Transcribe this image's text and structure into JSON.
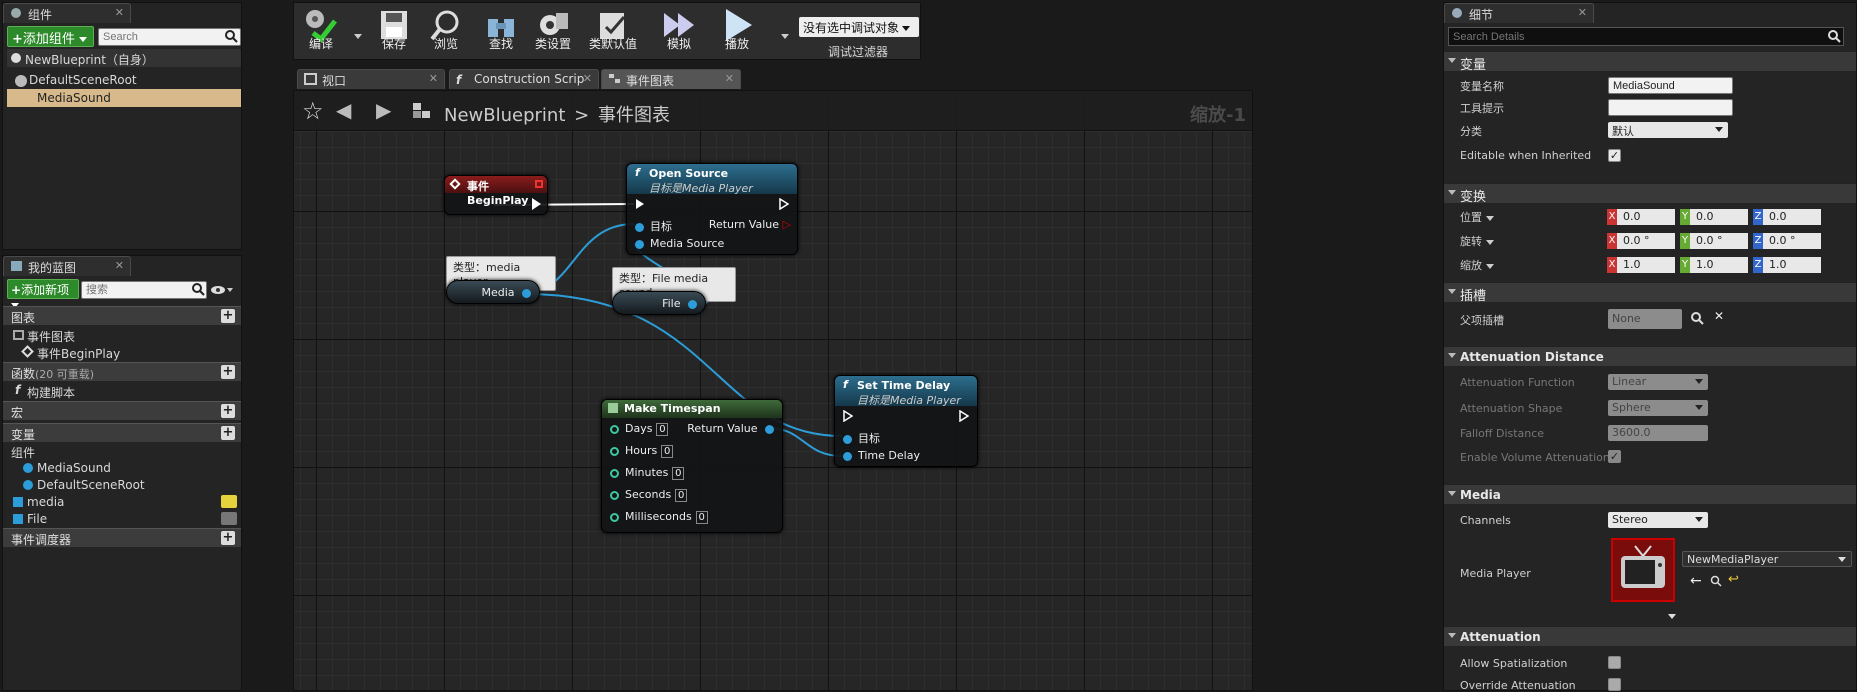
{
  "components_panel": {
    "tab_label": "组件",
    "add_button": "添加组件",
    "search_placeholder": "Search",
    "self_item": "NewBlueprint（自身）",
    "root_item": "DefaultSceneRoot",
    "child_item": "MediaSound"
  },
  "toolbar": {
    "buttons": [
      "编译",
      "保存",
      "浏览",
      "查找",
      "类设置",
      "类默认值",
      "模拟",
      "播放"
    ],
    "debug_filter_value": "没有选中调试对象",
    "debug_filter_label": "调试过滤器"
  },
  "editor_tabs": [
    "视口",
    "Construction Scrip",
    "事件图表"
  ],
  "graph_header": {
    "blueprint_name": "NewBlueprint",
    "separator": ">",
    "graph_name": "事件图表",
    "zoom": "缩放-1"
  },
  "nodes": {
    "begin_play": "事件BeginPlay",
    "open_source": {
      "title": "Open Source",
      "subtitle": "目标是Media Player",
      "pins": [
        "目标",
        "Media Source"
      ],
      "output": "Return Value"
    },
    "media_var": {
      "tooltip": "类型：media player",
      "label": "Media"
    },
    "file_var": {
      "tooltip": "类型：File media sound",
      "label": "File"
    },
    "make_timespan": {
      "title": "Make Timespan",
      "pins": [
        "Days",
        "Hours",
        "Minutes",
        "Seconds",
        "Milliseconds"
      ],
      "defaults": [
        "0",
        "0",
        "0",
        "0",
        "0"
      ],
      "output": "Return Value"
    },
    "set_time_delay": {
      "title": "Set Time Delay",
      "subtitle": "目标是Media Player",
      "pins": [
        "目标",
        "Time Delay"
      ]
    }
  },
  "my_blueprint": {
    "tab_label": "我的蓝图",
    "add_button": "添加新项",
    "search_placeholder": "搜索",
    "graphs_section": "图表",
    "event_graph": "事件图表",
    "begin_play": "事件BeginPlay",
    "functions_section": "函数",
    "functions_count": "(20 可重载)",
    "construction_script": "构建脚本",
    "macros_section": "宏",
    "variables_section": "变量",
    "components_group": "组件",
    "var_media_sound": "MediaSound",
    "var_default_root": "DefaultSceneRoot",
    "var_media": "media",
    "var_file": "File",
    "dispatchers_section": "事件调度器"
  },
  "details": {
    "tab_label": "细节",
    "search_placeholder": "Search Details",
    "sec_variable": "变量",
    "var_name_label": "变量名称",
    "var_name_value": "MediaSound",
    "tooltip_label": "工具提示",
    "tooltip_value": "",
    "category_label": "分类",
    "category_value": "默认",
    "editable_label": "Editable when Inherited",
    "sec_transform": "变换",
    "location_label": "位置",
    "rotation_label": "旋转",
    "scale_label": "缩放",
    "location": [
      "0.0",
      "0.0",
      "0.0"
    ],
    "rotation": [
      "0.0 °",
      "0.0 °",
      "0.0 °"
    ],
    "scale": [
      "1.0",
      "1.0",
      "1.0"
    ],
    "sec_socket": "插槽",
    "parent_socket_label": "父项插槽",
    "parent_socket_value": "None",
    "sec_attenuation_distance": "Attenuation Distance",
    "att_function_label": "Attenuation Function",
    "att_function_value": "Linear",
    "att_shape_label": "Attenuation Shape",
    "att_shape_value": "Sphere",
    "falloff_label": "Falloff Distance",
    "falloff_value": "3600.0",
    "enable_volume_label": "Enable Volume Attenuation",
    "sec_media": "Media",
    "channels_label": "Channels",
    "channels_value": "Stereo",
    "media_player_label": "Media Player",
    "media_player_value": "NewMediaPlayer",
    "sec_attenuation": "Attenuation",
    "allow_spatialization_label": "Allow Spatialization",
    "override_attenuation_label": "Override Attenuation"
  }
}
